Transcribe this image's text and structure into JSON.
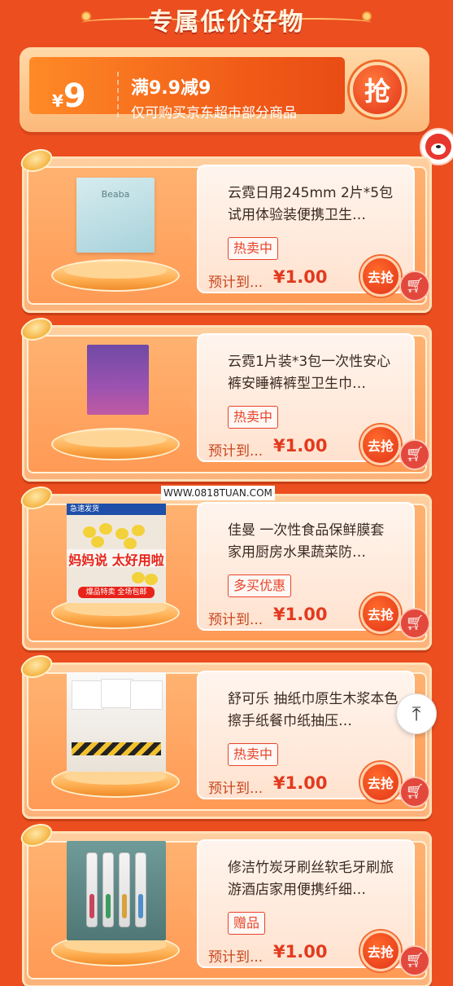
{
  "header": {
    "title": "专属低价好物"
  },
  "coupon": {
    "currency": "¥",
    "amount": "9",
    "title": "满9.9减9",
    "description": "仅可购买京东超市部分商品",
    "grab_label": "抢"
  },
  "products": [
    {
      "title": "云霓日用245mm 2片*5包试用体验装便携卫生…",
      "tag": "热卖中",
      "estimate_label": "预计到...",
      "price": "¥1.00",
      "grab_label": "去抢",
      "image_brand": "Beaba"
    },
    {
      "title": "云霓1片装*3包一次性安心裤安睡裤裤型卫生巾…",
      "tag": "热卖中",
      "estimate_label": "预计到...",
      "price": "¥1.00",
      "grab_label": "去抢"
    },
    {
      "title": "佳曼 一次性食品保鲜膜套 家用厨房水果蔬菜防…",
      "tag": "多买优惠",
      "estimate_label": "预计到...",
      "price": "¥1.00",
      "grab_label": "去抢",
      "image_top": "急速发货",
      "image_mid": "妈妈说 太好用啦",
      "image_bottom": "爆品特卖 全场包邮"
    },
    {
      "title": "舒可乐 抽纸巾原生木浆本色擦手纸餐巾纸抽压…",
      "tag": "热卖中",
      "estimate_label": "预计到...",
      "price": "¥1.00",
      "grab_label": "去抢"
    },
    {
      "title": "修洁竹炭牙刷丝软毛牙刷旅游酒店家用便携纤细…",
      "tag": "赠品",
      "estimate_label": "预计到...",
      "price": "¥1.00",
      "grab_label": "去抢"
    }
  ],
  "watermark": "WWW.0818TUAN.COM",
  "icons": {
    "cart": "cart-icon",
    "back_to_top": "arrow-up-icon",
    "mascot": "mascot-icon"
  },
  "colors": {
    "background": "#ec4e1f",
    "price": "#e23a1f",
    "tag": "#e8432a"
  }
}
